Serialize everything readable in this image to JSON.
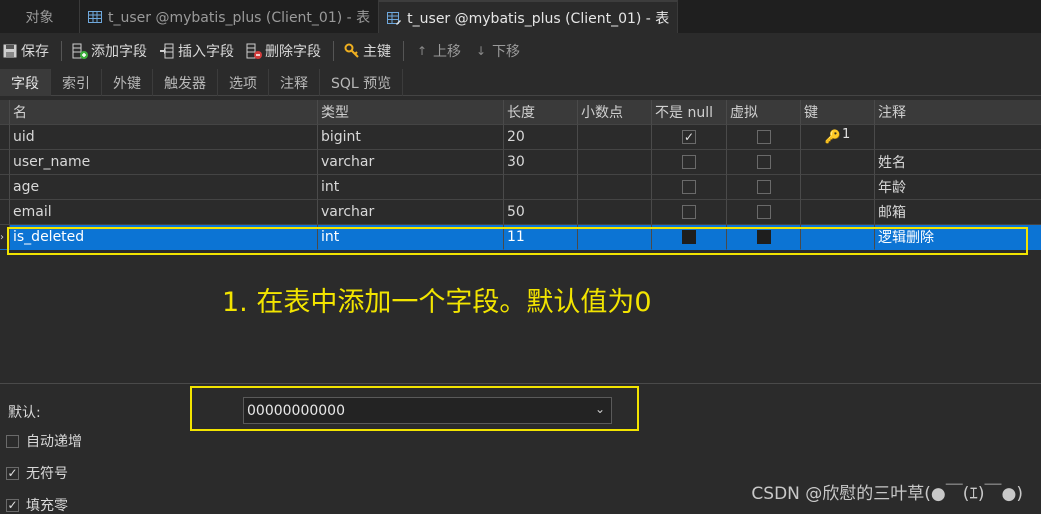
{
  "tabs": [
    {
      "label": "对象"
    },
    {
      "label": "t_user @mybatis_plus (Client_01) - 表"
    },
    {
      "label": "t_user @mybatis_plus (Client_01) - 表"
    }
  ],
  "toolbar": {
    "save": "保存",
    "add_field": "添加字段",
    "insert_field": "插入字段",
    "delete_field": "删除字段",
    "primary_key": "主键",
    "move_up": "上移",
    "move_down": "下移"
  },
  "subtabs": [
    "字段",
    "索引",
    "外键",
    "触发器",
    "选项",
    "注释",
    "SQL 预览"
  ],
  "grid": {
    "headers": [
      "名",
      "类型",
      "长度",
      "小数点",
      "不是 null",
      "虚拟",
      "键",
      "注释"
    ],
    "rows": [
      {
        "name": "uid",
        "type": "bigint",
        "length": "20",
        "decimals": "",
        "not_null": true,
        "virtual": false,
        "key": "1",
        "comment": ""
      },
      {
        "name": "user_name",
        "type": "varchar",
        "length": "30",
        "decimals": "",
        "not_null": false,
        "virtual": false,
        "key": "",
        "comment": "姓名"
      },
      {
        "name": "age",
        "type": "int",
        "length": "",
        "decimals": "",
        "not_null": false,
        "virtual": false,
        "key": "",
        "comment": "年龄"
      },
      {
        "name": "email",
        "type": "varchar",
        "length": "50",
        "decimals": "",
        "not_null": false,
        "virtual": false,
        "key": "",
        "comment": "邮箱"
      },
      {
        "name": "is_deleted",
        "type": "int",
        "length": "11",
        "decimals": "",
        "not_null": false,
        "virtual": false,
        "key": "",
        "comment": "逻辑删除"
      }
    ]
  },
  "annotation": "1. 在表中添加一个字段。默认值为0",
  "field_props": {
    "default_label": "默认:",
    "default_value": "00000000000",
    "auto_increment": {
      "label": "自动递增",
      "checked": false
    },
    "unsigned": {
      "label": "无符号",
      "checked": true
    },
    "zerofill": {
      "label": "填充零",
      "checked": true
    }
  },
  "watermark": "CSDN @欣慰的三叶草(●￣(ｴ)￣●)",
  "colors": {
    "selection": "#0c74d4",
    "highlight": "#f2e400",
    "key": "#f0b020"
  }
}
